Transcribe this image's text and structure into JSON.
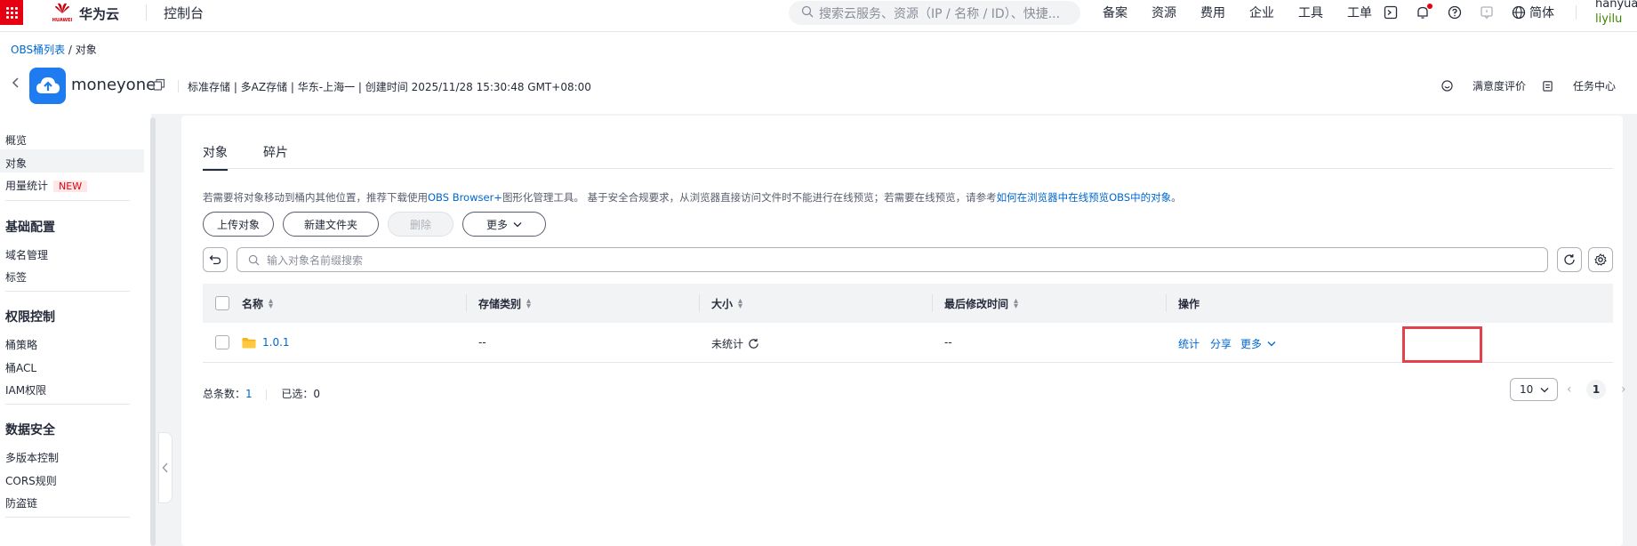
{
  "nav": {
    "logo_cn": "华为云",
    "logo_small": "HUAWEI",
    "console": "控制台",
    "search_placeholder": "搜索云服务、资源（IP / 名称 / ID）、快捷...",
    "links": [
      "备案",
      "资源",
      "费用",
      "企业",
      "工具",
      "工单"
    ],
    "lang": "简体",
    "user_name": "hanyua",
    "user_sub": "liyilu",
    "accent": "#e60012"
  },
  "breadcrumb": {
    "parent": "OBS桶列表",
    "sep": "/",
    "current": "对象"
  },
  "bucket": {
    "name": "moneyone",
    "meta": "标准存储 | 多AZ存储 | 华东-上海一 | 创建时间  2025/11/28 15:30:48 GMT+08:00",
    "feedback": "满意度评价",
    "tasks": "任务中心"
  },
  "sidebar": {
    "overview": "概览",
    "objects": "对象",
    "usage": "用量统计",
    "new_tag": "NEW",
    "basic_head": "基础配置",
    "domain": "域名管理",
    "tags": "标签",
    "perm_head": "权限控制",
    "policy": "桶策略",
    "acl": "桶ACL",
    "iam": "IAM权限",
    "sec_head": "数据安全",
    "versioning": "多版本控制",
    "cors": "CORS规则",
    "hotlink": "防盗链"
  },
  "tabs": [
    "对象",
    "碎片"
  ],
  "info": {
    "part1": "若需要将对象移动到桶内其他位置，推荐下载使用",
    "link1": "OBS Browser+",
    "part2": "图形化管理工具。 基于安全合规要求，从浏览器直接访问文件时不能进行在线预览；若需要在线预览，请参考",
    "link2": "如何在浏览器中在线预览OBS中的对象",
    "part3": "。"
  },
  "buttons": {
    "upload": "上传对象",
    "new_folder": "新建文件夹",
    "delete": "删除",
    "more": "更多"
  },
  "search": {
    "placeholder": "输入对象名前缀搜索"
  },
  "table": {
    "headers": [
      "名称",
      "存储类别",
      "大小",
      "最后修改时间",
      "操作"
    ],
    "rows": [
      {
        "name": "1.0.1",
        "storage": "--",
        "size": "未统计",
        "modified": "--",
        "ops": [
          "统计",
          "分享",
          "更多"
        ]
      }
    ]
  },
  "footer": {
    "total_label": "总条数：",
    "total": "1",
    "selected_label": "已选：",
    "selected": "0",
    "page_size": "10",
    "page": "1"
  }
}
